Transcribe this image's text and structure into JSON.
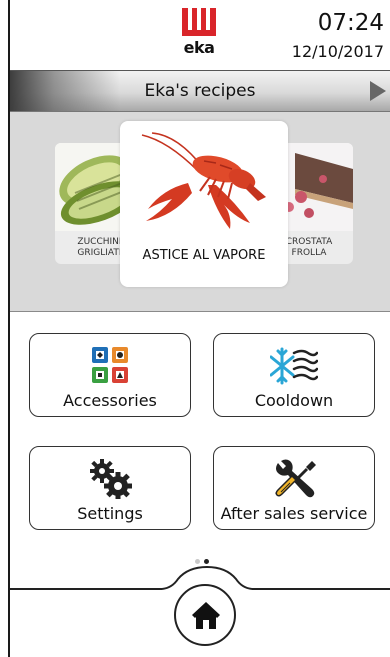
{
  "header": {
    "brand": "eka",
    "time": "07:24",
    "date": "12/10/2017"
  },
  "titlebar": {
    "title": "Eka's recipes"
  },
  "carousel": {
    "left_caption_line1": "ZUCCHINE",
    "left_caption_line2": "GRIGLIATE",
    "main_caption": "ASTICE AL VAPORE",
    "right_caption_line1": "CROSTATA",
    "right_caption_line2": "FROLLA",
    "page_indicator": {
      "count": 2,
      "active": 2
    }
  },
  "tiles": {
    "accessories": "Accessories",
    "cooldown": "Cooldown",
    "settings": "Settings",
    "after_sales": "After sales service"
  },
  "colors": {
    "brand_red": "#d9252a",
    "carousel_bg": "#d9d9d9",
    "cooldown_blue": "#2aa6d6",
    "accessory_blue": "#1f6fb7",
    "accessory_orange": "#e8892b",
    "accessory_green": "#3aa041",
    "accessory_red": "#d94235"
  },
  "icons": {
    "home": "home-icon",
    "next": "chevron-right-icon",
    "accessories": "accessories-grid-icon",
    "cooldown": "snowflake-wind-icon",
    "settings": "gears-icon",
    "after_sales": "tools-icon"
  }
}
